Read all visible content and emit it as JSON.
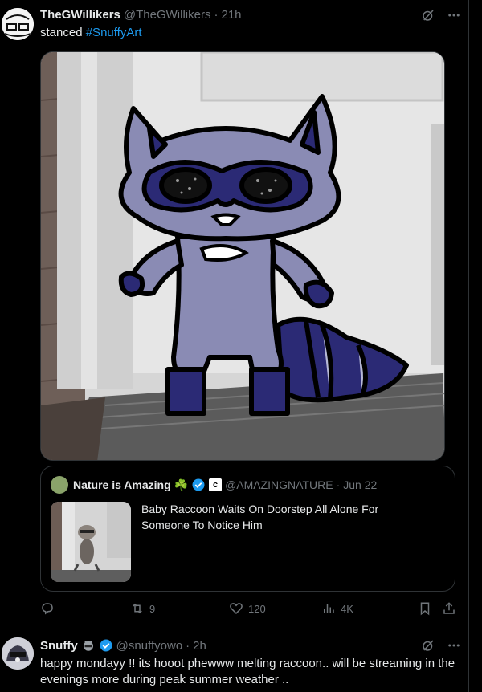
{
  "tweet1": {
    "name": "TheGWillikers",
    "handle": "@TheGWillikers",
    "dot": "·",
    "time": "21h",
    "text_prefix": "stanced ",
    "hashtag": "#SnuffyArt",
    "quote": {
      "name": "Nature is Amazing",
      "emoji": "☘️",
      "handle": "@AMAZINGNATURE",
      "dot": "·",
      "date": "Jun 22",
      "affiliate_letter": "c",
      "text": "Baby Raccoon Waits On Doorstep All Alone For Someone To Notice Him"
    },
    "actions": {
      "reply_count": "",
      "retweet_count": "9",
      "like_count": "120",
      "views_count": "4K"
    }
  },
  "tweet2": {
    "name": "Snuffy",
    "handle": "@snuffyowo",
    "dot": "·",
    "time": "2h",
    "text": "happy mondayy !! its hooot phewww melting raccoon.. will be streaming in the evenings more during peak summer weather .."
  },
  "colors": {
    "accent": "#1d9bf0",
    "muted": "#71767b",
    "border": "#2f3336",
    "raccoon_body": "#8a8bb4",
    "raccoon_dark": "#2b2a75"
  },
  "icons": [
    "grok-icon",
    "more-icon",
    "reply-icon",
    "retweet-icon",
    "like-icon",
    "views-icon",
    "bookmark-icon",
    "share-icon",
    "verified-badge-icon"
  ]
}
